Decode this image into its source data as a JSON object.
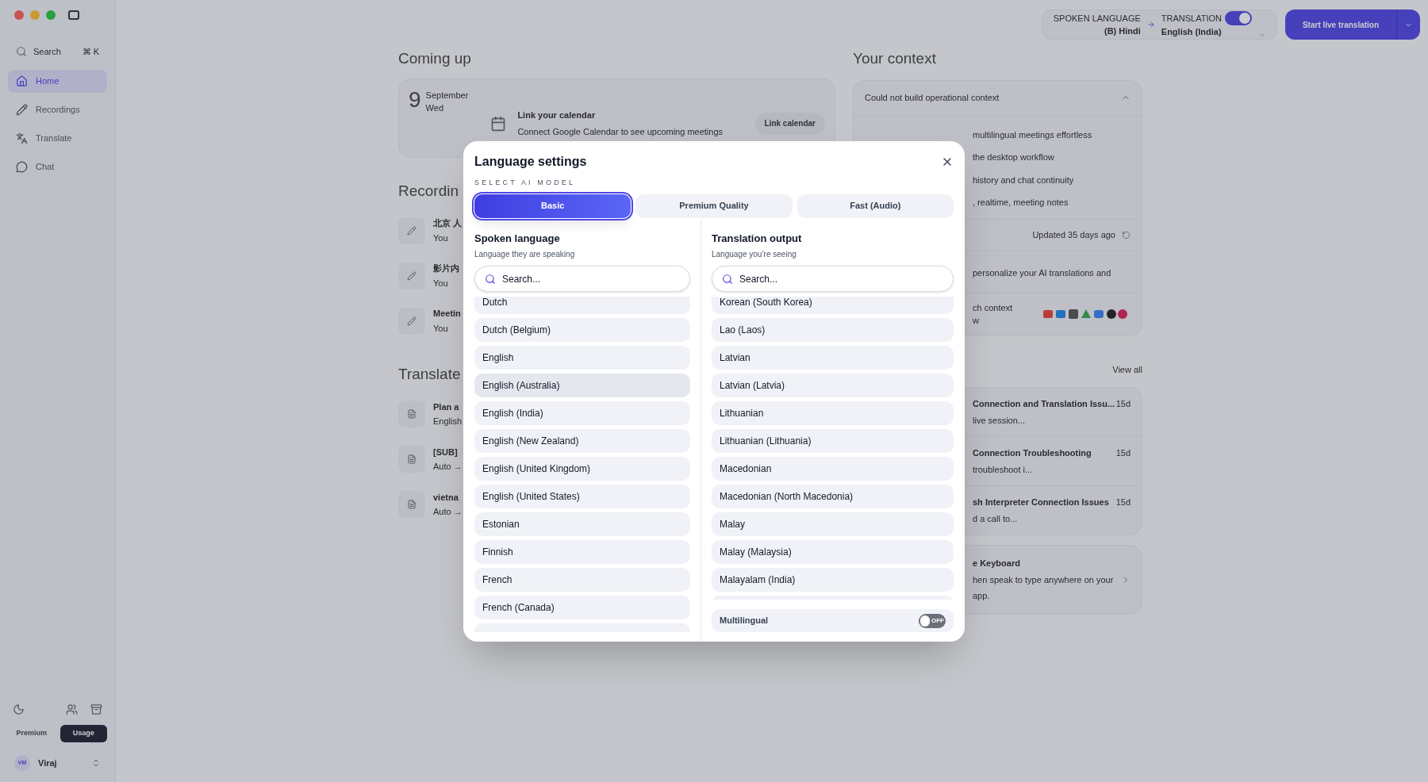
{
  "sidebar": {
    "search": {
      "placeholder": "Search",
      "shortcut": "⌘ K"
    },
    "items": [
      {
        "label": "Home",
        "selected": true
      },
      {
        "label": "Recordings",
        "selected": false
      },
      {
        "label": "Translate",
        "selected": false
      },
      {
        "label": "Chat",
        "selected": false
      }
    ],
    "plan_tabs": [
      {
        "label": "Premium",
        "selected": false
      },
      {
        "label": "Usage",
        "selected": true
      }
    ],
    "user": {
      "initials": "VM",
      "name": "Viraj"
    }
  },
  "top_bar": {
    "spoken_label": "SPOKEN LANGUAGE",
    "spoken_value": "(B) Hindi",
    "translation_label": "TRANSLATION",
    "translation_on": true,
    "translation_value": "English (India)",
    "start_button": "Start live translation"
  },
  "coming_up": {
    "title": "Coming up",
    "day": "9",
    "month": "September",
    "weekday": "Wed",
    "calendar_title": "Link your calendar",
    "calendar_text": "Connect Google Calendar to see upcoming meetings",
    "calendar_button": "Link calendar"
  },
  "recordings": {
    "title": "Recordin",
    "items": [
      {
        "title": "北京 人",
        "subtitle": "You"
      },
      {
        "title": "影片内",
        "subtitle": "You"
      },
      {
        "title": "Meetin",
        "subtitle": "You"
      }
    ]
  },
  "translated": {
    "title": "Translate",
    "items": [
      {
        "title": "Plan a",
        "subtitle": "English"
      },
      {
        "title": "[SUB]",
        "subtitle": "Auto →"
      },
      {
        "title": "vietna",
        "subtitle": "Auto →"
      }
    ]
  },
  "context": {
    "title": "Your context",
    "status": "Could not build operational context",
    "expanded": true,
    "bullets": [
      "multilingual meetings effortless",
      "the desktop workflow",
      "history and chat continuity",
      ", realtime, meeting notes"
    ],
    "updated": "Updated 35 days ago",
    "personalize": "personalize your AI translations and",
    "connect_lines": [
      "ch context",
      "w"
    ]
  },
  "conversations": {
    "view_all": "View all",
    "items": [
      {
        "title": "Connection and Translation Issu...",
        "time": "15d",
        "snippet": "live session..."
      },
      {
        "title": "Connection Troubleshooting",
        "time": "15d",
        "snippet": "troubleshoot i..."
      },
      {
        "title": "sh Interpreter Connection Issues",
        "time": "15d",
        "snippet": "d a call to..."
      }
    ]
  },
  "keyboard": {
    "title": "e Keyboard",
    "lines": [
      "hen speak to type anywhere on your",
      "app."
    ]
  },
  "dialog": {
    "title": "Language settings",
    "section_label": "SELECT AI MODEL",
    "models": [
      {
        "label": "Basic",
        "selected": true
      },
      {
        "label": "Premium Quality",
        "selected": false
      },
      {
        "label": "Fast (Audio)",
        "selected": false
      }
    ],
    "spoken": {
      "title": "Spoken language",
      "subtitle": "Language they are speaking",
      "search_placeholder": "Search...",
      "items": [
        {
          "label": "Dutch",
          "selected": false
        },
        {
          "label": "Dutch (Belgium)",
          "selected": false
        },
        {
          "label": "English",
          "selected": false
        },
        {
          "label": "English (Australia)",
          "selected": true
        },
        {
          "label": "English (India)",
          "selected": false
        },
        {
          "label": "English (New Zealand)",
          "selected": false
        },
        {
          "label": "English (United Kingdom)",
          "selected": false
        },
        {
          "label": "English (United States)",
          "selected": false
        },
        {
          "label": "Estonian",
          "selected": false
        },
        {
          "label": "Finnish",
          "selected": false
        },
        {
          "label": "French",
          "selected": false
        },
        {
          "label": "French (Canada)",
          "selected": false
        }
      ]
    },
    "output": {
      "title": "Translation output",
      "subtitle": "Language you’re seeing",
      "search_placeholder": "Search...",
      "items": [
        {
          "label": "Korean (South Korea)",
          "selected": false
        },
        {
          "label": "Lao (Laos)",
          "selected": false
        },
        {
          "label": "Latvian",
          "selected": false
        },
        {
          "label": "Latvian (Latvia)",
          "selected": false
        },
        {
          "label": "Lithuanian",
          "selected": false
        },
        {
          "label": "Lithuanian (Lithuania)",
          "selected": false
        },
        {
          "label": "Macedonian",
          "selected": false
        },
        {
          "label": "Macedonian (North Macedonia)",
          "selected": false
        },
        {
          "label": "Malay",
          "selected": false
        },
        {
          "label": "Malay (Malaysia)",
          "selected": false
        },
        {
          "label": "Malayalam (India)",
          "selected": false
        }
      ]
    },
    "multilingual": {
      "label": "Multilingual",
      "on": false,
      "state_text": "OFF"
    }
  }
}
